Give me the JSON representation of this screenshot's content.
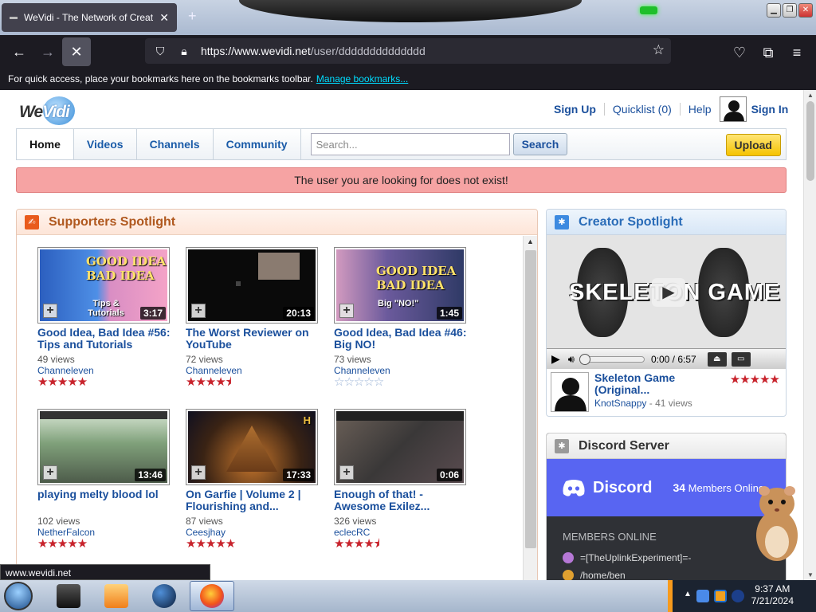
{
  "browser": {
    "tab_title": "WeVidi - The Network of Creat",
    "url_host": "https://www.wevidi.net",
    "url_path": "/user/dddddddddddddd",
    "bookmarks_msg": "For quick access, place your bookmarks here on the bookmarks toolbar.",
    "bookmarks_link": "Manage bookmarks...",
    "status_url": "www.wevidi.net"
  },
  "header": {
    "sign_up": "Sign Up",
    "quicklist": "Quicklist (0)",
    "help": "Help",
    "sign_in": "Sign In"
  },
  "nav": {
    "home": "Home",
    "videos": "Videos",
    "channels": "Channels",
    "community": "Community",
    "search_placeholder": "Search...",
    "search_btn": "Search",
    "upload": "Upload"
  },
  "alert": "The user you are looking for does not exist!",
  "supporters": {
    "title": "Supporters Spotlight",
    "videos": [
      {
        "title": "Good Idea, Bad Idea #56: Tips and Tutorials",
        "duration": "3:17",
        "views": "49 views",
        "user": "Channeleven",
        "rating": 5,
        "thumb_text": "Tips & Tutorials"
      },
      {
        "title": "The Worst Reviewer on YouTube",
        "duration": "20:13",
        "views": "72 views",
        "user": "Channeleven",
        "rating": 4.5,
        "thumb_text": ""
      },
      {
        "title": "Good Idea, Bad Idea #46: Big NO!",
        "duration": "1:45",
        "views": "73 views",
        "user": "Channeleven",
        "rating": 0,
        "thumb_text": "Big \"NO!\""
      },
      {
        "title": "playing melty blood lol",
        "duration": "13:46",
        "views": "102 views",
        "user": "NetherFalcon",
        "rating": 5,
        "thumb_text": ""
      },
      {
        "title": "On Garfie | Volume 2 | Flourishing and...",
        "duration": "17:33",
        "views": "87 views",
        "user": "Ceesjhay",
        "rating": 5,
        "thumb_text": ""
      },
      {
        "title": "Enough of that! - Awesome Exilez...",
        "duration": "0:06",
        "views": "326 views",
        "user": "eclecRC",
        "rating": 4.5,
        "thumb_text": ""
      }
    ]
  },
  "creator": {
    "title": "Creator Spotlight",
    "screen_text": "SKELETON GAME",
    "time": "0:00 / 6:57",
    "video_title": "Skeleton Game (Original...",
    "user": "KnotSnappy",
    "views": "- 41 views",
    "rating": 5
  },
  "discord": {
    "title": "Discord Server",
    "brand": "Discord",
    "members_count": "34",
    "members_label": "Members Online",
    "online_header": "MEMBERS ONLINE",
    "members": [
      "=[TheUplinkExperiment]=-",
      "/home/ben"
    ]
  },
  "taskbar": {
    "time": "9:37 AM",
    "date": "7/21/2024"
  }
}
